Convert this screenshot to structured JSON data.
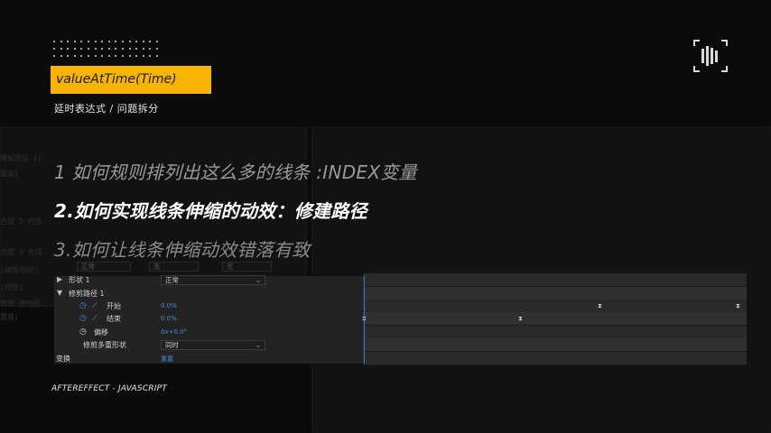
{
  "badge": {
    "title": "valueAtTime(Time)"
  },
  "subtitle": "延时表达式 / 问题拆分",
  "headings": [
    "1 如何规则排列出这么多的线条 :INDEX变量",
    "2.如何实现线条伸缩的动效：修建路径",
    "3.如何让线条伸缩动效错落有致"
  ],
  "timeline": {
    "top_dropdowns": [
      "正常",
      "无",
      "无"
    ],
    "rows": [
      {
        "label": "形状 1",
        "dropdown": "正常"
      },
      {
        "label": "修剪路径 1"
      },
      {
        "label": "开始",
        "value": "0.0%"
      },
      {
        "label": "结束",
        "value": "0.0%"
      },
      {
        "label": "偏移",
        "value": "0x+0.0°"
      },
      {
        "label": "修剪多重形状",
        "dropdown": "同时"
      },
      {
        "label": "变换",
        "value": "重置"
      }
    ]
  },
  "background_text": [
    "模板图层 1]",
    "置换]",
    "合成 3 合成",
    "合成 3 合成",
    "[精简版AE]",
    "[按钮]",
    "背景-德地图...",
    "置换]"
  ],
  "footer": "AFTEREFFECT - JAVASCRIPT"
}
